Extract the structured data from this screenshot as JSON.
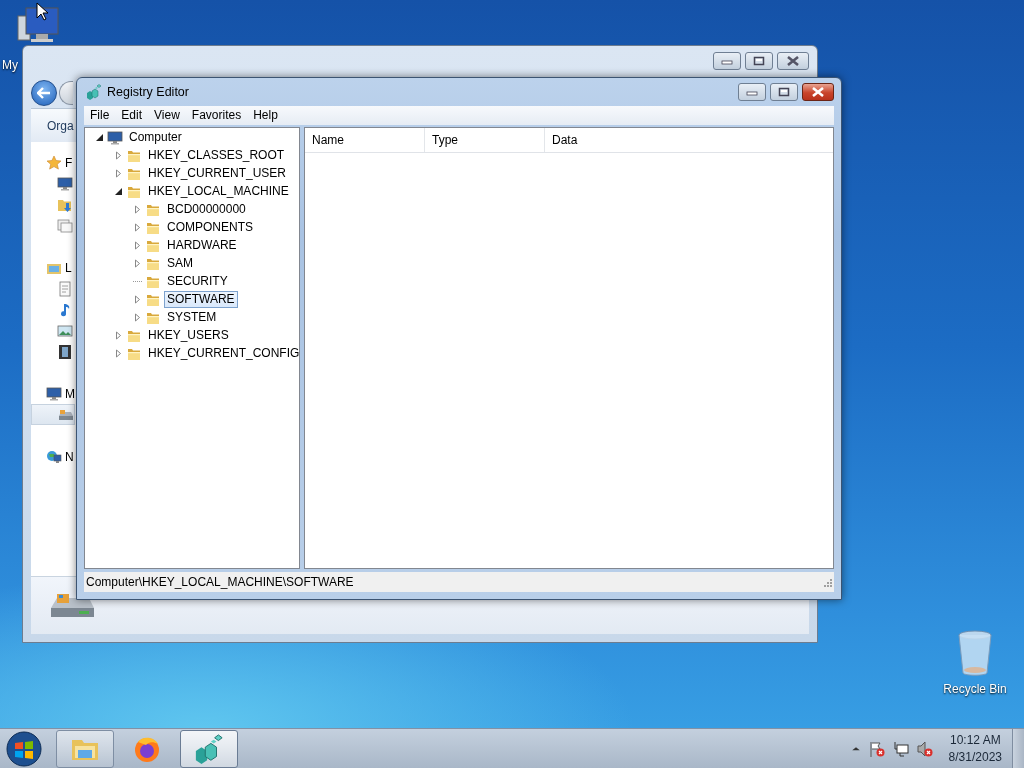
{
  "desktop_icons": [
    {
      "kind": "computer",
      "label": "My"
    },
    {
      "kind": "recycle_bin",
      "label": "Recycle Bin"
    }
  ],
  "explorer_window": {
    "toolbar_label": "Orga",
    "nav_groups": [
      {
        "kind": "favorites",
        "label": "F",
        "selected": false,
        "children": [
          {
            "kind": "desktop",
            "selected": false
          },
          {
            "kind": "downloads",
            "selected": false
          },
          {
            "kind": "recent",
            "selected": false
          }
        ]
      },
      {
        "kind": "libraries",
        "label": "L",
        "selected": false,
        "children": [
          {
            "kind": "documents",
            "selected": false
          },
          {
            "kind": "music",
            "selected": false
          },
          {
            "kind": "pictures",
            "selected": false
          },
          {
            "kind": "videos",
            "selected": false
          }
        ]
      },
      {
        "kind": "computer",
        "label": "M",
        "selected": false,
        "children": [
          {
            "kind": "drive",
            "selected": true
          }
        ]
      },
      {
        "kind": "network",
        "label": "N",
        "selected": false
      }
    ]
  },
  "registry_editor": {
    "title": "Registry Editor",
    "menu": [
      "File",
      "Edit",
      "View",
      "Favorites",
      "Help"
    ],
    "tree": [
      {
        "kind": "computer",
        "label": "Computer",
        "expandable": true,
        "expanded": true,
        "selected": false,
        "children": [
          {
            "kind": "folder",
            "label": "HKEY_CLASSES_ROOT",
            "expandable": true,
            "expanded": false,
            "selected": false
          },
          {
            "kind": "folder",
            "label": "HKEY_CURRENT_USER",
            "expandable": true,
            "expanded": false,
            "selected": false
          },
          {
            "kind": "folder",
            "label": "HKEY_LOCAL_MACHINE",
            "expandable": true,
            "expanded": true,
            "selected": false,
            "children": [
              {
                "kind": "folder",
                "label": "BCD00000000",
                "expandable": true,
                "expanded": false,
                "selected": false
              },
              {
                "kind": "folder",
                "label": "COMPONENTS",
                "expandable": true,
                "expanded": false,
                "selected": false
              },
              {
                "kind": "folder",
                "label": "HARDWARE",
                "expandable": true,
                "expanded": false,
                "selected": false
              },
              {
                "kind": "folder",
                "label": "SAM",
                "expandable": true,
                "expanded": false,
                "selected": false
              },
              {
                "kind": "folder",
                "label": "SECURITY",
                "expandable": false,
                "selected": false
              },
              {
                "kind": "folder",
                "label": "SOFTWARE",
                "expandable": true,
                "expanded": false,
                "selected": true
              },
              {
                "kind": "folder",
                "label": "SYSTEM",
                "expandable": true,
                "expanded": false,
                "selected": false
              }
            ]
          },
          {
            "kind": "folder",
            "label": "HKEY_USERS",
            "expandable": true,
            "expanded": false,
            "selected": false
          },
          {
            "kind": "folder",
            "label": "HKEY_CURRENT_CONFIG",
            "expandable": true,
            "expanded": false,
            "selected": false
          }
        ]
      }
    ],
    "columns": [
      "Name",
      "Type",
      "Data"
    ],
    "status_bar": "Computer\\HKEY_LOCAL_MACHINE\\SOFTWARE"
  },
  "taskbar": {
    "buttons": [
      {
        "kind": "explorer",
        "running": true,
        "selected": false
      },
      {
        "kind": "firefox",
        "running": false,
        "selected": false
      },
      {
        "kind": "regedit",
        "running": true,
        "selected": true
      }
    ],
    "clock": {
      "time": "10:12 AM",
      "date": "8/31/2023"
    }
  }
}
